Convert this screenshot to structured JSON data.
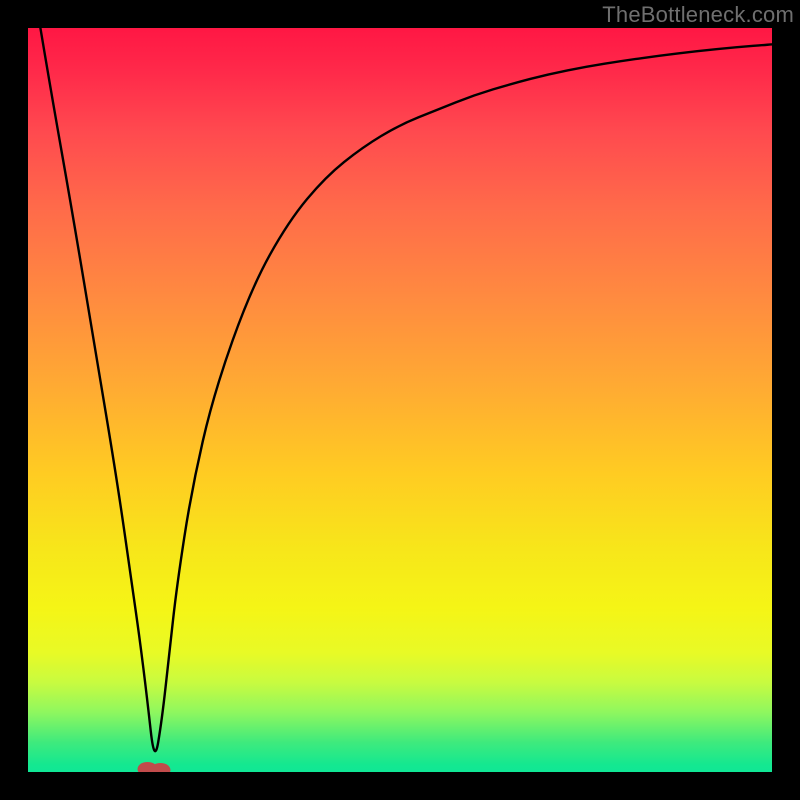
{
  "watermark": {
    "text": "TheBottleneck.com"
  },
  "chart_data": {
    "type": "line",
    "title": "",
    "xlabel": "",
    "ylabel": "",
    "xlim": [
      0,
      100
    ],
    "ylim": [
      0,
      100
    ],
    "background_gradient": {
      "orientation": "vertical",
      "stops": [
        {
          "pos": 0,
          "color": "#ff1744",
          "meaning": "high-bottleneck"
        },
        {
          "pos": 50,
          "color": "#ffcc22",
          "meaning": "medium-bottleneck"
        },
        {
          "pos": 100,
          "color": "#10e796",
          "meaning": "no-bottleneck"
        }
      ]
    },
    "optimal_x": 17,
    "optimal_marker": {
      "x": 17,
      "y": 0,
      "color": "#c14b4b",
      "shape": "rounded-blob"
    },
    "series": [
      {
        "name": "bottleneck-curve",
        "color": "#000000",
        "x": [
          0,
          3,
          6,
          9,
          12,
          14,
          15,
          16,
          17,
          18,
          19,
          20,
          22,
          25,
          30,
          35,
          40,
          45,
          50,
          55,
          60,
          65,
          70,
          75,
          80,
          85,
          90,
          95,
          100
        ],
        "values": [
          110,
          92,
          75,
          57,
          39,
          25,
          18,
          10,
          1,
          7,
          16,
          25,
          38,
          51,
          65,
          74,
          80,
          84,
          87,
          89,
          91,
          92.5,
          93.8,
          94.8,
          95.6,
          96.3,
          96.9,
          97.4,
          97.8
        ]
      }
    ]
  }
}
